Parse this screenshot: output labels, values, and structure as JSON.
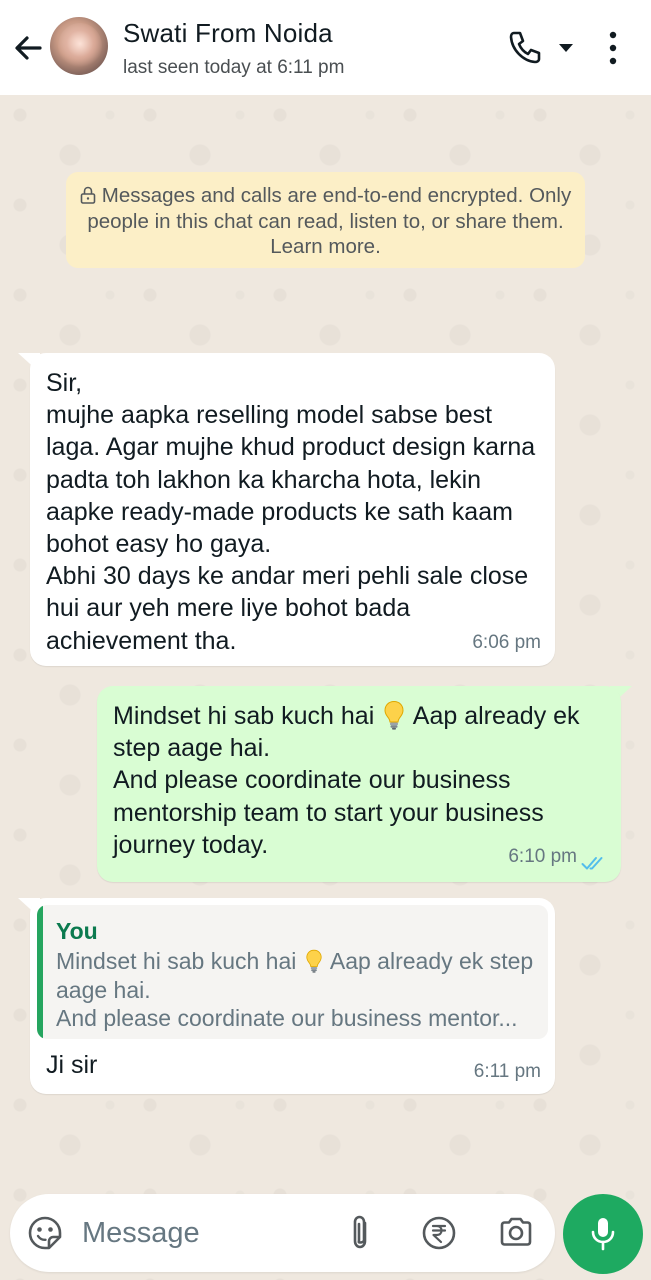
{
  "header": {
    "contact_name": "Swati From Noida",
    "last_seen": "last seen today at 6:11 pm"
  },
  "encryption_notice": {
    "text": "Messages and calls are end-to-end encrypted. Only people in this chat can read, listen to, or share them. Learn more."
  },
  "messages": [
    {
      "direction": "incoming",
      "text": "Sir,\nmujhe aapka reselling model sabse best laga. Agar mujhe khud product design karna padta toh lakhon ka kharcha hota, lekin aapke ready-made products ke sath kaam bohot easy ho gaya.\nAbhi 30 days ke andar meri pehli sale close hui aur yeh mere liye bohot bada achievement tha.",
      "time": "6:06 pm"
    },
    {
      "direction": "outgoing",
      "text_before_emoji": "Mindset hi sab kuch hai ",
      "emoji": "light-bulb",
      "text_after_emoji": " Aap already ek step aage hai.\nAnd please coordinate our business mentorship team to start your business journey today.",
      "time": "6:10 pm",
      "status": "read"
    },
    {
      "direction": "incoming",
      "quote": {
        "author": "You",
        "text_before_emoji": "Mindset hi sab kuch hai ",
        "emoji": "light-bulb",
        "text_after_emoji": " Aap already ek step aage hai.\nAnd please coordinate our business mentor..."
      },
      "text": "Ji sir",
      "time": "6:11 pm"
    }
  ],
  "composer": {
    "placeholder": "Message"
  },
  "colors": {
    "outgoing_bubble": "#d9fdd3",
    "incoming_bubble": "#ffffff",
    "notice_bg": "#fcefc7",
    "accent_green": "#1eaa61",
    "read_ticks": "#53bdeb"
  }
}
